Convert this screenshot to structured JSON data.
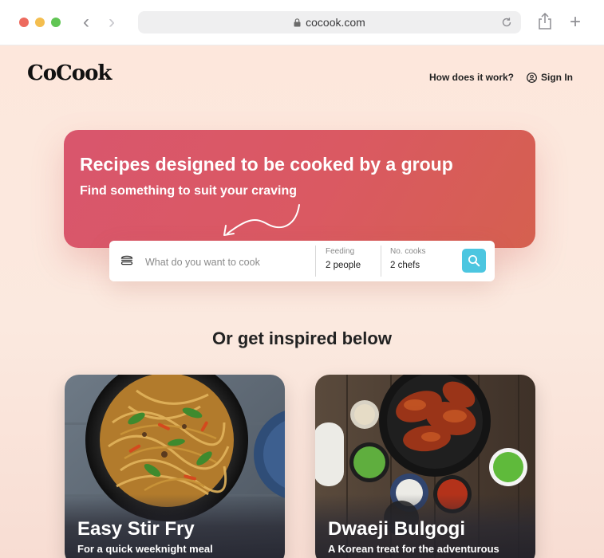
{
  "browser": {
    "url": "cocook.com"
  },
  "header": {
    "logo": "CoCook",
    "how_link": "How does it work?",
    "signin": "Sign In"
  },
  "hero": {
    "title": "Recipes designed to be cooked by a group",
    "subtitle": "Find something to suit your craving"
  },
  "search": {
    "placeholder": "What do you want to cook",
    "feeding_label": "Feeding",
    "feeding_value": "2 people",
    "cooks_label": "No. cooks",
    "cooks_value": "2 chefs"
  },
  "section": {
    "title": "Or get inspired below"
  },
  "cards": [
    {
      "title": "Easy Stir Fry",
      "subtitle": "For a quick weeknight meal"
    },
    {
      "title": "Dwaeji Bulgogi",
      "subtitle": "A Korean treat for the adventurous"
    }
  ],
  "colors": {
    "accent": "#d9566d",
    "search_button": "#4cc6e0",
    "background": "#fbe6dc"
  }
}
